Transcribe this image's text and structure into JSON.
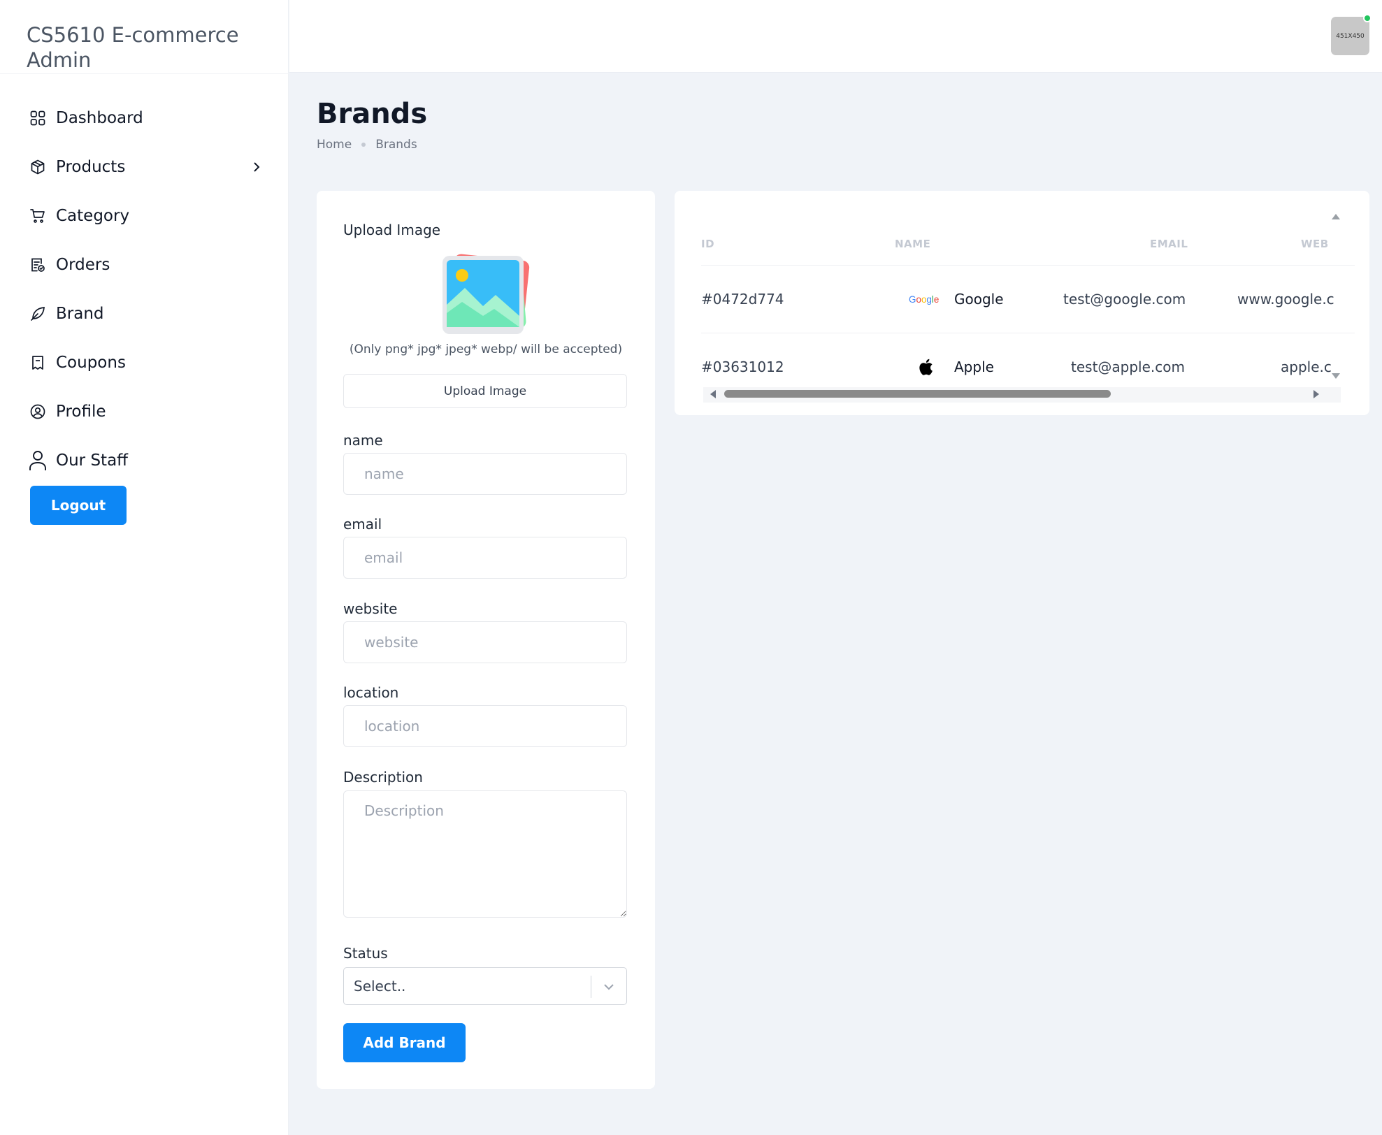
{
  "app": {
    "title": "CS5610 E-commerce Admin"
  },
  "sidebar": {
    "items": [
      {
        "label": "Dashboard",
        "icon": "grid-icon"
      },
      {
        "label": "Products",
        "icon": "box-icon"
      },
      {
        "label": "Category",
        "icon": "cart-icon"
      },
      {
        "label": "Orders",
        "icon": "clipboard-check-icon"
      },
      {
        "label": "Brand",
        "icon": "leaf-icon"
      },
      {
        "label": "Coupons",
        "icon": "ticket-icon"
      },
      {
        "label": "Profile",
        "icon": "user-circle-icon"
      },
      {
        "label": "Our Staff",
        "icon": "user-icon"
      }
    ],
    "logout_label": "Logout"
  },
  "header": {
    "avatar_text": "451X450",
    "status_color": "#22c55e"
  },
  "page": {
    "title": "Brands",
    "breadcrumb": {
      "home": "Home",
      "current": "Brands"
    }
  },
  "form": {
    "upload_label": "Upload Image",
    "upload_hint": "(Only png* jpg* jpeg* webp/ will be accepted)",
    "upload_button": "Upload Image",
    "name_label": "name",
    "name_placeholder": "name",
    "email_label": "email",
    "email_placeholder": "email",
    "website_label": "website",
    "website_placeholder": "website",
    "location_label": "location",
    "location_placeholder": "location",
    "description_label": "Description",
    "description_placeholder": "Description",
    "status_label": "Status",
    "status_value": "Select..",
    "submit_label": "Add Brand"
  },
  "table": {
    "columns": [
      "ID",
      "NAME",
      "EMAIL",
      "WEB"
    ],
    "rows": [
      {
        "id": "#0472d774",
        "logo": "Google",
        "name": "Google",
        "email": "test@google.com",
        "website": "www.google.c"
      },
      {
        "id": "#03631012",
        "logo": "apple-logo-icon",
        "name": "Apple",
        "email": "test@apple.com",
        "website": "apple.c"
      }
    ]
  },
  "colors": {
    "accent": "#0d87f5",
    "background": "#f0f3f8"
  }
}
